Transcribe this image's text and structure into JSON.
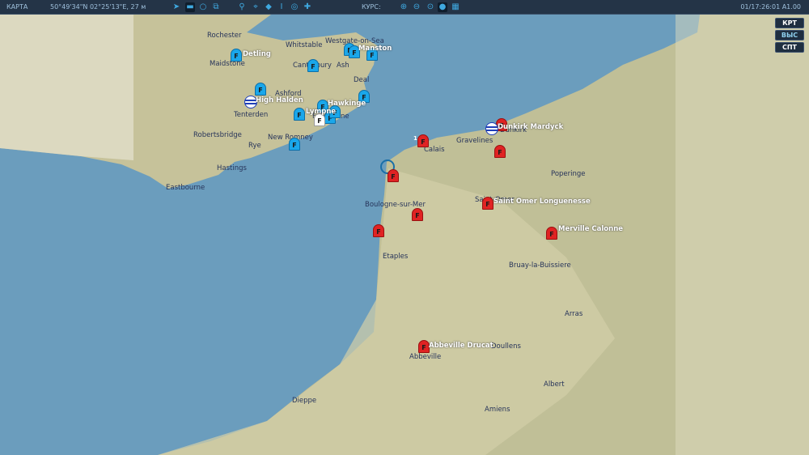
{
  "topbar": {
    "mode": "КАРТА",
    "coords": "50°49'34\"N 02°25'13\"E, 27 м",
    "course_label": "КУРС:",
    "time": "01/17:26:01 A1.00",
    "icons": [
      "navigate-icon",
      "label-toggle-icon",
      "circle-icon",
      "layers-icon",
      "route-icon",
      "target-icon",
      "wifi-icon",
      "beacon-icon",
      "chat-icon",
      "cross-icon",
      "zoom-in-icon",
      "zoom-out-icon",
      "zoom-fit-icon",
      "globe-icon",
      "grid-icon"
    ]
  },
  "side_buttons": [
    "КРТ",
    "ВЫС",
    "СПТ"
  ],
  "cities": [
    "Rochester",
    "Maidstone",
    "Whitstable",
    "Westgate-on-Sea",
    "Canterbury",
    "Ash",
    "Deal",
    "Tenterden",
    "Robertsbridge",
    "Rye",
    "New Romney",
    "Hastings",
    "Eastbourne",
    "Calais",
    "Gravelines",
    "Dunkirk",
    "Poperinge",
    "Saint-Omer",
    "Boulogne-sur-Mer",
    "Etaples",
    "Bruay-la-Buissiere",
    "Arras",
    "Abbeville",
    "Doullens",
    "Albert",
    "Dieppe",
    "Amiens",
    "Ashford",
    "Lympne",
    "Folkestone"
  ],
  "airbases": [
    "Detling",
    "Manston",
    "High Halden",
    "Hawkinge",
    "Lympne",
    "Dunkirk Mardyck",
    "Saint Omer Longuenesse",
    "Merville Calonne",
    "Abbeville Drucat"
  ],
  "colors": {
    "sea": "#6b9dbd",
    "land": "#c9c59c",
    "blue": "#1aa7ea",
    "red": "#e02323",
    "topbar": "#243447"
  }
}
